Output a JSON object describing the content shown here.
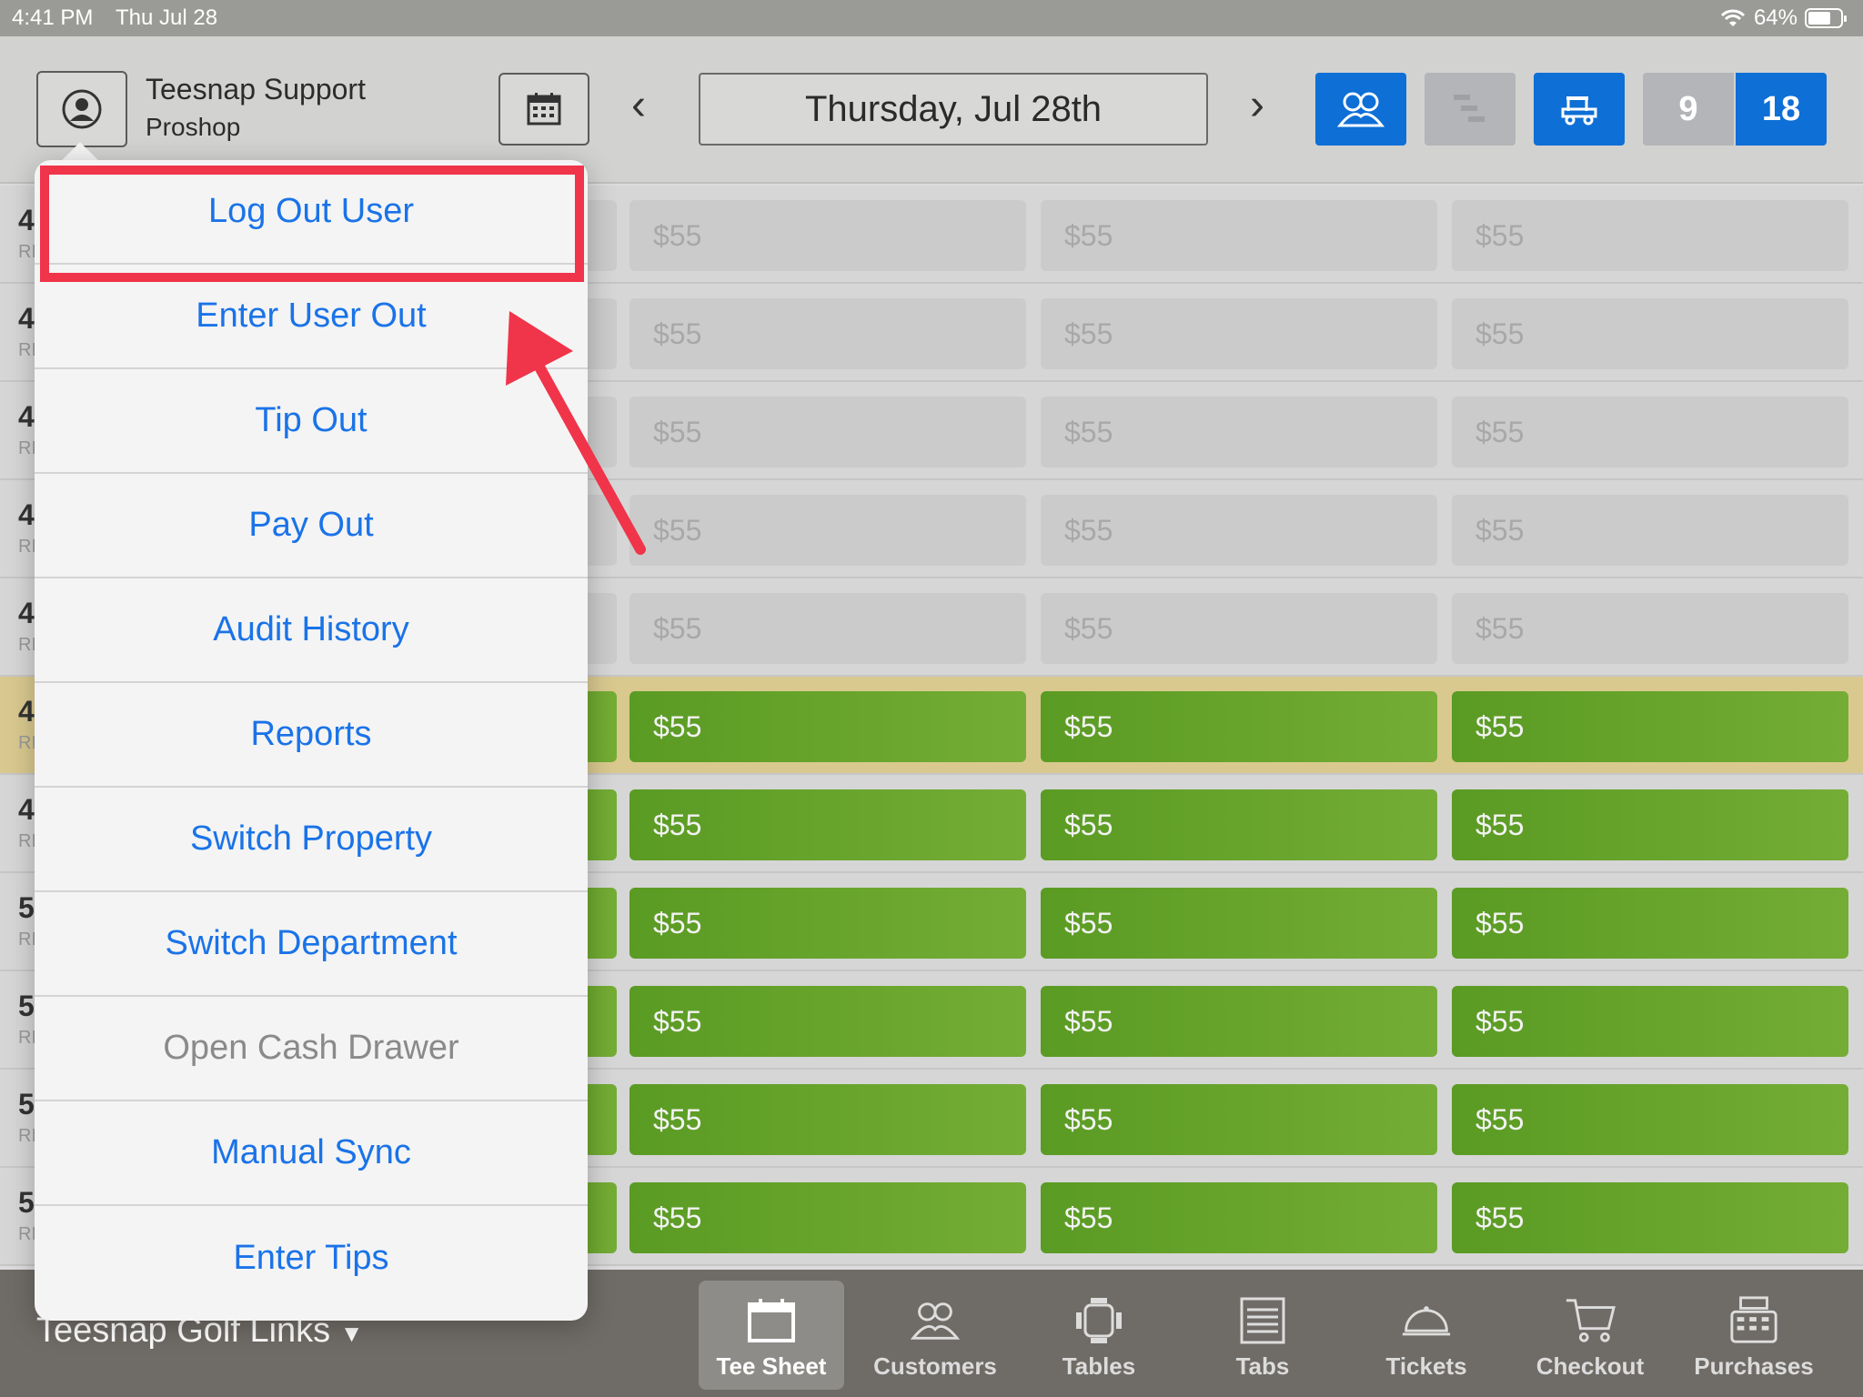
{
  "status_bar": {
    "time": "4:41 PM",
    "date": "Thu Jul 28",
    "battery": "64%"
  },
  "header": {
    "user_name": "Teesnap Support",
    "user_department": "Proshop",
    "date_label": "Thursday, Jul 28th",
    "prev_icon": "chevron-left-icon",
    "next_icon": "chevron-right-icon",
    "holes_9": "9",
    "holes_18": "18",
    "colors": {
      "active": "#0e6fd6",
      "inactive": "#b3b5b8"
    }
  },
  "tee_rows": [
    {
      "time": "4",
      "sub": "RI",
      "cells": [
        "$55",
        "$55",
        "$55"
      ],
      "status": "open"
    },
    {
      "time": "4",
      "sub": "RI",
      "cells": [
        "$55",
        "$55",
        "$55"
      ],
      "status": "open"
    },
    {
      "time": "4",
      "sub": "RI",
      "cells": [
        "$55",
        "$55",
        "$55"
      ],
      "status": "open"
    },
    {
      "time": "4",
      "sub": "RI",
      "cells": [
        "$55",
        "$55",
        "$55"
      ],
      "status": "open"
    },
    {
      "time": "4",
      "sub": "RI",
      "cells": [
        "$55",
        "$55",
        "$55"
      ],
      "status": "open"
    },
    {
      "time": "4",
      "sub": "RI",
      "cells": [
        "$55",
        "$55",
        "$55"
      ],
      "status": "booked"
    },
    {
      "time": "4",
      "sub": "RI",
      "cells": [
        "$55",
        "$55",
        "$55"
      ],
      "status": "booked"
    },
    {
      "time": "5",
      "sub": "RI",
      "cells": [
        "$55",
        "$55",
        "$55"
      ],
      "status": "booked"
    },
    {
      "time": "5",
      "sub": "RI",
      "cells": [
        "$55",
        "$55",
        "$55"
      ],
      "status": "booked"
    },
    {
      "time": "5",
      "sub": "RI",
      "cells": [
        "$55",
        "$55",
        "$55"
      ],
      "status": "booked"
    },
    {
      "time": "5",
      "sub": "RI",
      "cells": [
        "$55",
        "$55",
        "$55"
      ],
      "status": "booked"
    }
  ],
  "menu": {
    "items": [
      {
        "label": "Log Out User",
        "enabled": true
      },
      {
        "label": "Enter User Out",
        "enabled": true
      },
      {
        "label": "Tip Out",
        "enabled": true
      },
      {
        "label": "Pay Out",
        "enabled": true
      },
      {
        "label": "Audit History",
        "enabled": true
      },
      {
        "label": "Reports",
        "enabled": true
      },
      {
        "label": "Switch Property",
        "enabled": true
      },
      {
        "label": "Switch Department",
        "enabled": true
      },
      {
        "label": "Open Cash Drawer",
        "enabled": false
      },
      {
        "label": "Manual Sync",
        "enabled": true
      },
      {
        "label": "Enter Tips",
        "enabled": true
      }
    ],
    "highlight_color": "#f0344a"
  },
  "tab_bar": {
    "course_name": "Teesnap Golf Links",
    "tabs": [
      {
        "label": "Tee Sheet",
        "icon": "calendar-icon",
        "active": true
      },
      {
        "label": "Customers",
        "icon": "people-icon",
        "active": false
      },
      {
        "label": "Tables",
        "icon": "table-icon",
        "active": false
      },
      {
        "label": "Tabs",
        "icon": "receipt-icon",
        "active": false
      },
      {
        "label": "Tickets",
        "icon": "cloche-icon",
        "active": false
      },
      {
        "label": "Checkout",
        "icon": "cart-icon",
        "active": false
      },
      {
        "label": "Purchases",
        "icon": "register-icon",
        "active": false
      }
    ]
  }
}
